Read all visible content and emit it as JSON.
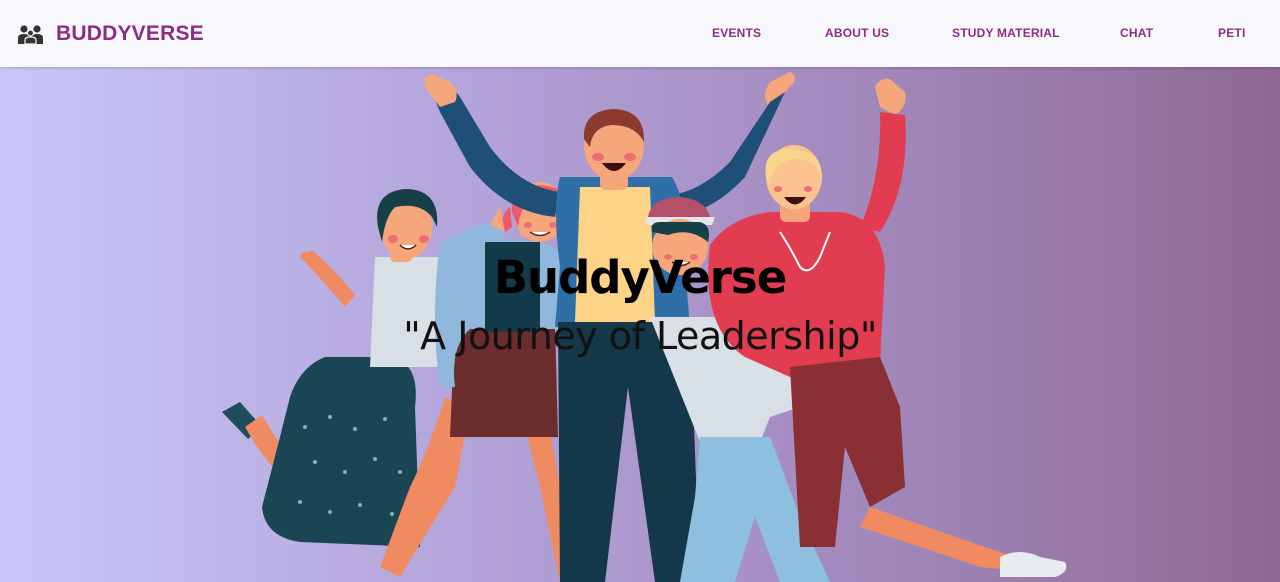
{
  "brand": {
    "name": "BUDDYVERSE",
    "icon": "group-icon"
  },
  "nav": {
    "items": [
      {
        "label": "EVENTS"
      },
      {
        "label": "ABOUT US"
      },
      {
        "label": "STUDY MATERIAL"
      },
      {
        "label": "CHAT"
      },
      {
        "label": "PETI"
      }
    ]
  },
  "hero": {
    "title": "BuddyVerse",
    "subtitle": "\"A Journey of Leadership\"",
    "illustration": "group-of-friends-illustration"
  },
  "colors": {
    "accent": "#8b2e83",
    "navbar_bg": "#f8f8fc",
    "hero_gradient_start": "#c8c7fa",
    "hero_gradient_end": "#8e6a93"
  }
}
